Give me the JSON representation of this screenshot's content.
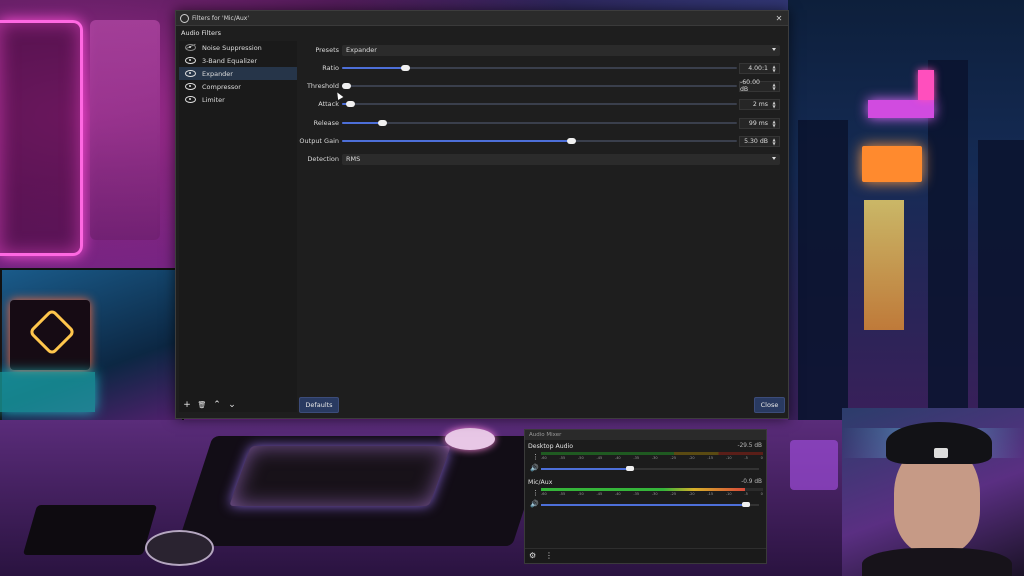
{
  "dialog": {
    "title": "Filters for 'Mic/Aux'",
    "close_glyph": "✕",
    "section_title": "Audio Filters",
    "filters": [
      {
        "label": "Noise Suppression",
        "enabled": false,
        "icon": "eye-slash-icon"
      },
      {
        "label": "3-Band Equalizer",
        "enabled": true,
        "icon": "eye-icon"
      },
      {
        "label": "Expander",
        "enabled": true,
        "icon": "eye-icon",
        "selected": true
      },
      {
        "label": "Compressor",
        "enabled": true,
        "icon": "eye-icon"
      },
      {
        "label": "Limiter",
        "enabled": true,
        "icon": "eye-icon"
      }
    ],
    "tools": {
      "add": "+",
      "remove": "🗑",
      "up": "⌃",
      "down": "⌄"
    },
    "properties": {
      "presets": {
        "label": "Presets",
        "value": "Expander"
      },
      "ratio": {
        "label": "Ratio",
        "value": "4.00:1",
        "level": 0.16
      },
      "threshold": {
        "label": "Threshold",
        "value": "-60.00 dB",
        "level": 0.01
      },
      "attack": {
        "label": "Attack",
        "value": "2 ms",
        "level": 0.02
      },
      "release": {
        "label": "Release",
        "value": "99 ms",
        "level": 0.1
      },
      "output_gain": {
        "label": "Output Gain",
        "value": "5.30 dB",
        "level": 0.58
      },
      "detection": {
        "label": "Detection",
        "value": "RMS"
      }
    },
    "buttons": {
      "defaults": "Defaults",
      "close": "Close"
    },
    "accent": "#4d6fd8"
  },
  "mixer": {
    "title": "Audio Mixer",
    "scale_labels": [
      "-60",
      "-55",
      "-50",
      "-45",
      "-40",
      "-35",
      "-30",
      "-25",
      "-20",
      "-15",
      "-10",
      "-5",
      "0"
    ],
    "sources": [
      {
        "name": "Desktop Audio",
        "db": "-29.5 dB",
        "meter_level": 0.0,
        "volume": 0.41
      },
      {
        "name": "Mic/Aux",
        "db": "-0.9 dB",
        "meter_level": 0.92,
        "volume": 0.94
      }
    ],
    "footer_icons": [
      "gear-icon",
      "kebab-menu-icon"
    ]
  }
}
